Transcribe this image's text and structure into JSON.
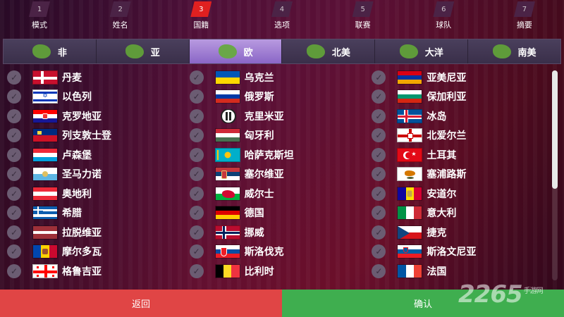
{
  "steps": [
    {
      "num": "1",
      "label": "模式"
    },
    {
      "num": "2",
      "label": "姓名"
    },
    {
      "num": "3",
      "label": "国籍",
      "active": true
    },
    {
      "num": "4",
      "label": "选项"
    },
    {
      "num": "5",
      "label": "联赛"
    },
    {
      "num": "6",
      "label": "球队"
    },
    {
      "num": "7",
      "label": "摘要"
    }
  ],
  "regions": [
    {
      "label": "非",
      "icon": "africa-icon"
    },
    {
      "label": "亚",
      "icon": "asia-icon"
    },
    {
      "label": "欧",
      "icon": "europe-icon",
      "active": true
    },
    {
      "label": "北美",
      "icon": "north-america-icon"
    },
    {
      "label": "大洋",
      "icon": "oceania-icon"
    },
    {
      "label": "南美",
      "icon": "south-america-icon"
    }
  ],
  "countries": [
    [
      {
        "name": "丹麦",
        "flag": "denmark-flag"
      },
      {
        "name": "以色列",
        "flag": "israel-flag"
      },
      {
        "name": "克罗地亚",
        "flag": "croatia-flag"
      },
      {
        "name": "列支敦士登",
        "flag": "liechtenstein-flag"
      },
      {
        "name": "卢森堡",
        "flag": "luxembourg-flag"
      },
      {
        "name": "圣马力诺",
        "flag": "san-marino-flag"
      },
      {
        "name": "奥地利",
        "flag": "austria-flag"
      },
      {
        "name": "希腊",
        "flag": "greece-flag"
      },
      {
        "name": "拉脱维亚",
        "flag": "latvia-flag"
      },
      {
        "name": "摩尔多瓦",
        "flag": "moldova-flag"
      },
      {
        "name": "格鲁吉亚",
        "flag": "georgia-flag"
      }
    ],
    [
      {
        "name": "乌克兰",
        "flag": "ukraine-flag"
      },
      {
        "name": "俄罗斯",
        "flag": "russia-flag"
      },
      {
        "name": "克里米亚",
        "flag": "crimea-flag"
      },
      {
        "name": "匈牙利",
        "flag": "hungary-flag"
      },
      {
        "name": "哈萨克斯坦",
        "flag": "kazakhstan-flag"
      },
      {
        "name": "塞尔维亚",
        "flag": "serbia-flag"
      },
      {
        "name": "威尔士",
        "flag": "wales-flag"
      },
      {
        "name": "德国",
        "flag": "germany-flag"
      },
      {
        "name": "挪威",
        "flag": "norway-flag"
      },
      {
        "name": "斯洛伐克",
        "flag": "slovakia-flag"
      },
      {
        "name": "比利时",
        "flag": "belgium-flag"
      }
    ],
    [
      {
        "name": "亚美尼亚",
        "flag": "armenia-flag"
      },
      {
        "name": "保加利亚",
        "flag": "bulgaria-flag"
      },
      {
        "name": "冰岛",
        "flag": "iceland-flag"
      },
      {
        "name": "北爱尔兰",
        "flag": "northern-ireland-flag"
      },
      {
        "name": "土耳其",
        "flag": "turkey-flag"
      },
      {
        "name": "塞浦路斯",
        "flag": "cyprus-flag"
      },
      {
        "name": "安道尔",
        "flag": "andorra-flag"
      },
      {
        "name": "意大利",
        "flag": "italy-flag"
      },
      {
        "name": "捷克",
        "flag": "czech-flag"
      },
      {
        "name": "斯洛文尼亚",
        "flag": "slovenia-flag"
      },
      {
        "name": "法国",
        "flag": "france-flag"
      }
    ]
  ],
  "buttons": {
    "back": "返回",
    "confirm": "确认"
  },
  "watermark": {
    "main": "2265",
    "sub": "手游网"
  },
  "colors": {
    "active_step": "#e02020",
    "active_tab": "#9a77d3",
    "back": "#e04545",
    "confirm": "#3fae4f"
  }
}
